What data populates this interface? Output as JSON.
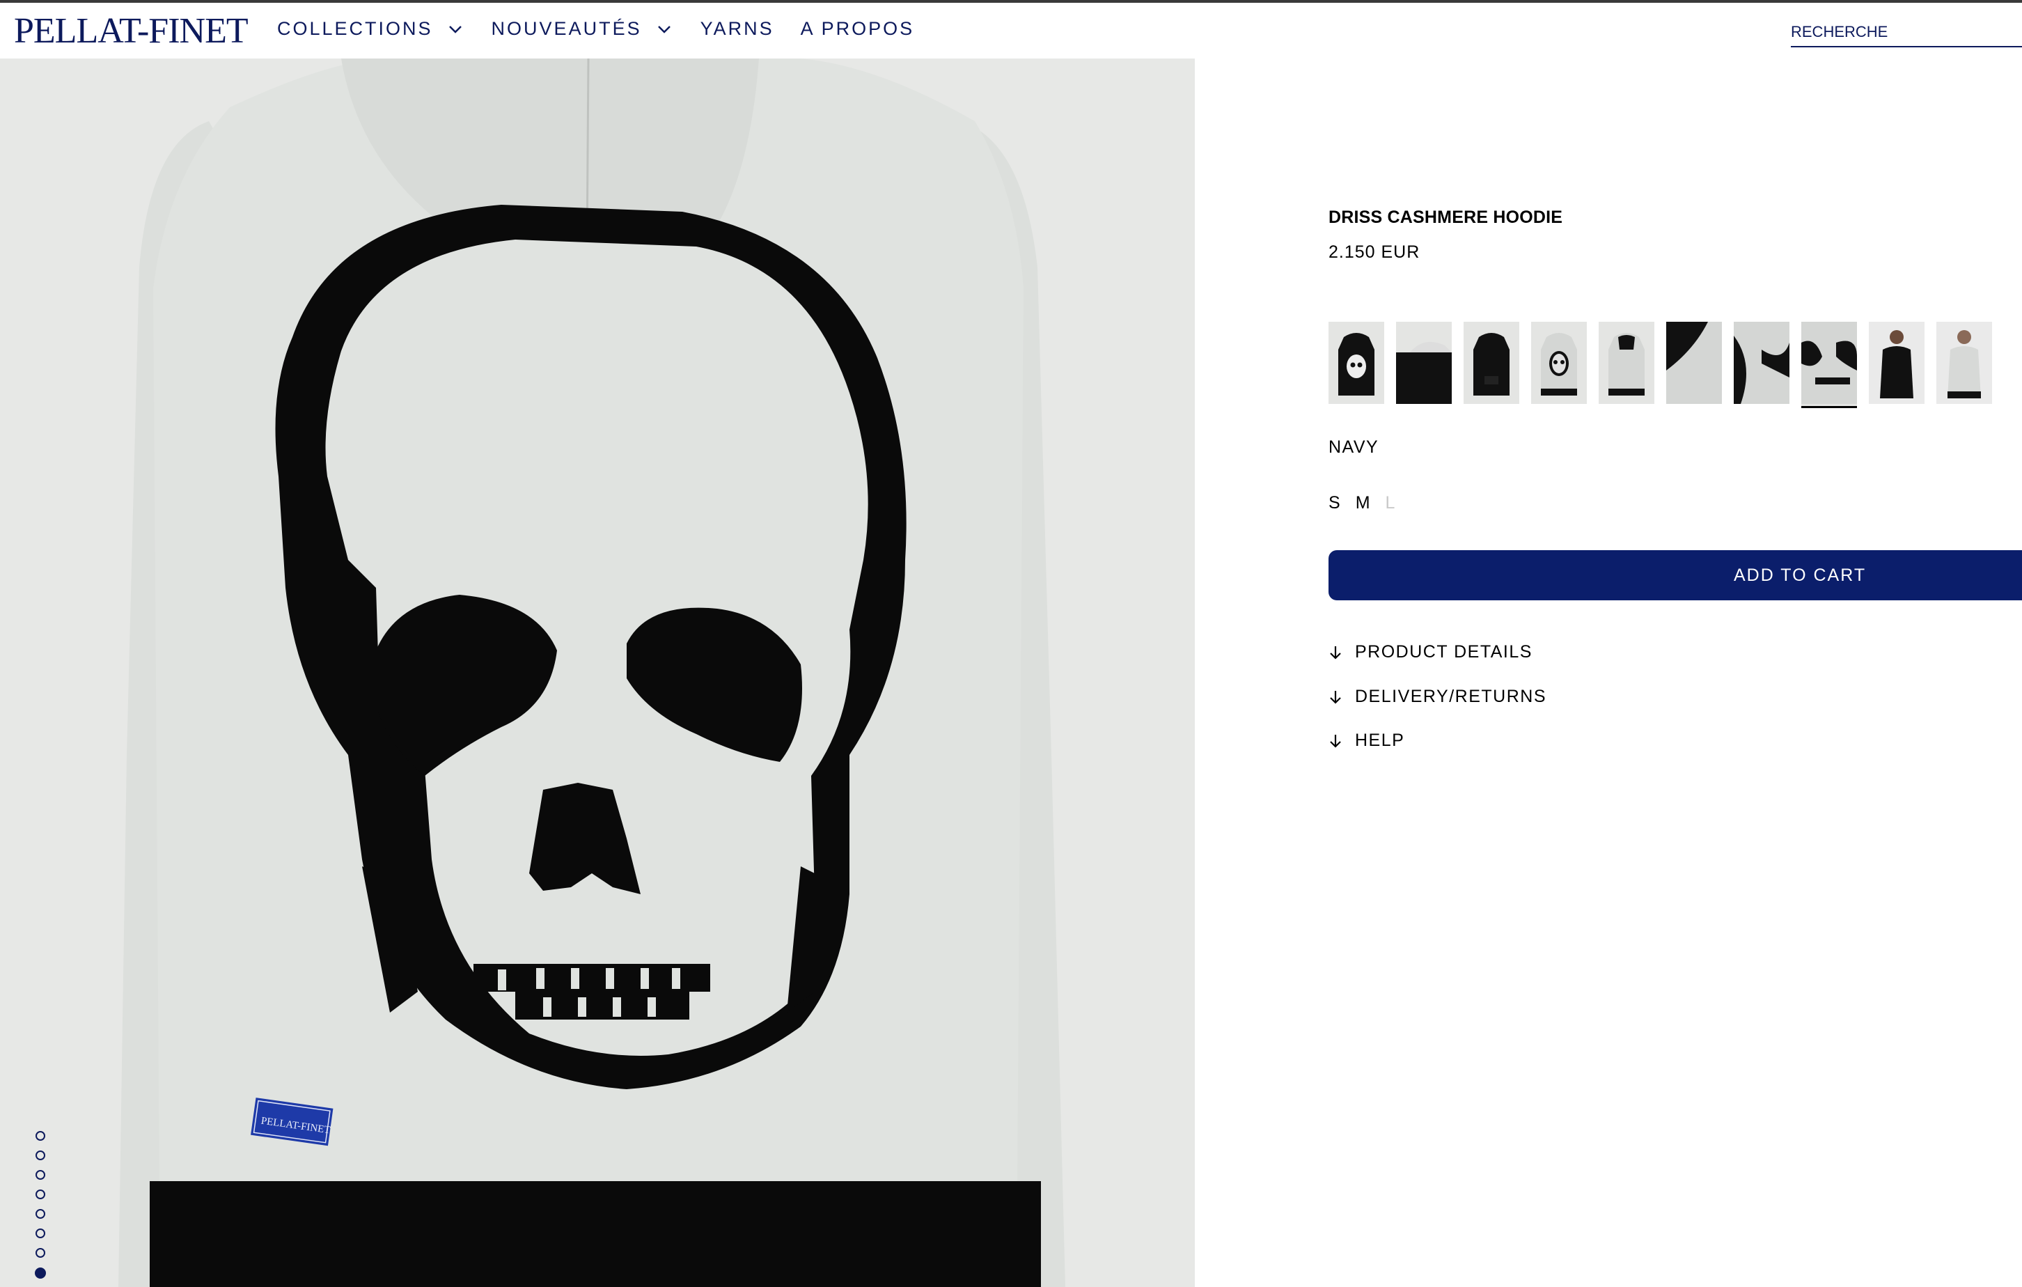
{
  "header": {
    "logo": "PELLAT-FINET",
    "nav": [
      {
        "label": "COLLECTIONS",
        "has_dropdown": true
      },
      {
        "label": "NOUVEAUTÉS",
        "has_dropdown": true
      },
      {
        "label": "YARNS",
        "has_dropdown": false
      },
      {
        "label": "A PROPOS",
        "has_dropdown": false
      }
    ],
    "search_placeholder": "RECHERCHE"
  },
  "gallery": {
    "slide_count": 10,
    "active_slide": 8,
    "label_text": "PELLAT-FINET"
  },
  "product": {
    "title": "DRISS CASHMERE HOODIE",
    "price": "2.150 EUR",
    "thumbnail_count": 10,
    "selected_thumbnail": 8,
    "color": "NAVY",
    "sizes": [
      {
        "label": "S",
        "available": true
      },
      {
        "label": "M",
        "available": true
      },
      {
        "label": "L",
        "available": false
      }
    ],
    "add_to_cart": "ADD TO CART",
    "accordions": [
      "PRODUCT DETAILS",
      "DELIVERY/RETURNS",
      "HELP"
    ]
  },
  "colors": {
    "brand_navy": "#0d1a5c",
    "button": "#0b1e6b",
    "garment": "#dfe2df",
    "skull": "#0a0a0a"
  }
}
